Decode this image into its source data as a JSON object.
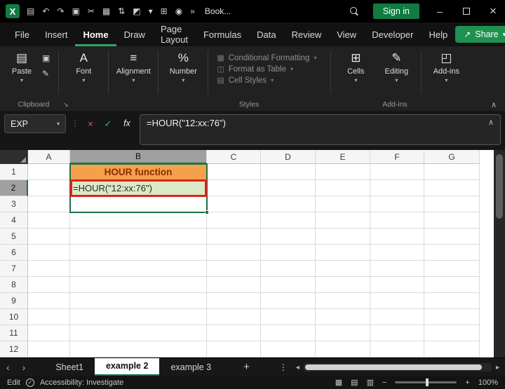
{
  "colors": {
    "accent_green": "#1E7145",
    "menu_underline_green": "#2DA661",
    "signin_green": "#107C41",
    "cell_fill_orange": "#F3A14B",
    "cell_title_text": "#8E2A00",
    "cell_fill_green": "#D8EBC6",
    "highlight_red": "#E02020"
  },
  "glyphs": {
    "caret": "▾",
    "collapse": "∧",
    "cancel": "×",
    "check": "✓",
    "fx": "fx",
    "vdots": "⋮",
    "prev": "‹",
    "next": "›",
    "left": "◄",
    "right": "►",
    "plus": "+",
    "minus": "−",
    "share": "↗",
    "logo": "X",
    "paste": "▤",
    "copy": "▣",
    "painter": "✎",
    "font": "A",
    "align": "≡",
    "number": "%",
    "cond": "▦",
    "table": "◫",
    "styles": "▤",
    "cells": "⊞",
    "editing": "✎",
    "addins": "◰",
    "launcher": "↘",
    "view_normal": "▦",
    "view_layout": "▤",
    "view_break": "▥",
    "accessibility": "✓"
  },
  "titlebar": {
    "workbook_name": "Book...",
    "sign_in_label": "Sign in",
    "window": {
      "minimize": "–",
      "close": "×"
    },
    "icons": [
      {
        "name": "save-icon",
        "glyph": "▤"
      },
      {
        "name": "undo-icon",
        "glyph": "↶"
      },
      {
        "name": "redo-icon",
        "glyph": "↷"
      },
      {
        "name": "copy-icon",
        "glyph": "▣"
      },
      {
        "name": "cut-icon",
        "glyph": "✂"
      },
      {
        "name": "picture-icon",
        "glyph": "▦"
      },
      {
        "name": "sort-icon",
        "glyph": "⇅"
      },
      {
        "name": "fill-color-icon",
        "glyph": "◩"
      },
      {
        "name": "dropdown-icon",
        "glyph": "▾"
      },
      {
        "name": "table-icon",
        "glyph": "⊞"
      },
      {
        "name": "camera-icon",
        "glyph": "◉"
      },
      {
        "name": "overflow-icon",
        "glyph": "»"
      }
    ]
  },
  "menubar": {
    "items": [
      "File",
      "Insert",
      "Home",
      "Draw",
      "Page Layout",
      "Formulas",
      "Data",
      "Review",
      "View",
      "Developer",
      "Help"
    ],
    "active_item": "Home",
    "share_label": "Share"
  },
  "ribbon": {
    "paste_label": "Paste",
    "font_label": "Font",
    "alignment_label": "Alignment",
    "number_label": "Number",
    "styles": [
      "Conditional Formatting",
      "Format as Table",
      "Cell Styles"
    ],
    "cells_label": "Cells",
    "editing_label": "Editing",
    "addins_label": "Add-ins",
    "group_labels": [
      "Clipboard",
      "Styles",
      "Add-ins"
    ]
  },
  "formula_bar": {
    "name_box": "EXP",
    "formula": "=HOUR(\"12:xx:76\")"
  },
  "grid": {
    "columns": [
      "A",
      "B",
      "C",
      "D",
      "E",
      "F",
      "G"
    ],
    "rows": [
      "1",
      "2",
      "3",
      "4",
      "5",
      "6",
      "7",
      "8",
      "9",
      "10",
      "11",
      "12"
    ],
    "selected_column": "B",
    "selected_row": "2",
    "cells": {
      "B1": {
        "text": "HOUR function",
        "class": "cell-title"
      },
      "B2": {
        "text": "=HOUR(\"12:xx:76\")",
        "class": "cell-formula"
      }
    }
  },
  "sheet_tabs": {
    "tabs": [
      "Sheet1",
      "example 2",
      "example 3"
    ],
    "active": "example 2"
  },
  "status_bar": {
    "mode": "Edit",
    "accessibility": "Accessibility: Investigate",
    "zoom": "100%"
  }
}
